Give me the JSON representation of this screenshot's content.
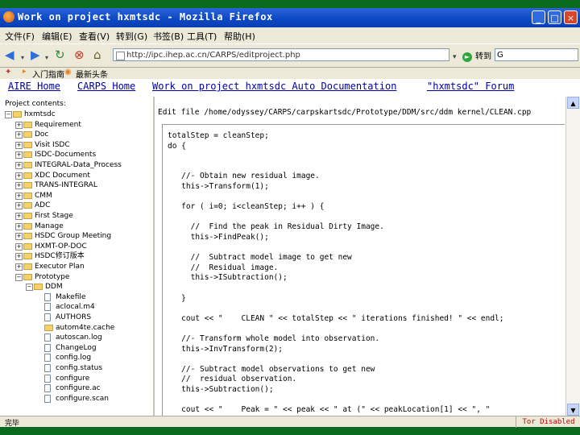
{
  "window": {
    "title": "Work on project hxmtsdc - Mozilla Firefox"
  },
  "menu": [
    "文件(F)",
    "编辑(E)",
    "查看(V)",
    "转到(G)",
    "书签(B)",
    "工具(T)",
    "帮助(H)"
  ],
  "nav": {
    "url": "http://ipc.ihep.ac.cn/CARPS/editproject.php",
    "go_label": "转到",
    "search_value": "G"
  },
  "bookmarks": [
    "入门指南",
    "最新头条"
  ],
  "links": [
    "AIRE Home",
    "CARPS Home",
    "Work on project hxmtsdc Auto Documentation",
    "\"hxmtsdc\" Forum"
  ],
  "tree": {
    "header": "Project contents:",
    "items": [
      {
        "label": "hxmtsdc",
        "type": "folder",
        "exp": "−",
        "indent": 0
      },
      {
        "label": "Requirement",
        "type": "folder",
        "exp": "+",
        "indent": 1
      },
      {
        "label": "Doc",
        "type": "folder",
        "exp": "+",
        "indent": 1
      },
      {
        "label": "Visit ISDC",
        "type": "folder",
        "exp": "+",
        "indent": 1
      },
      {
        "label": "ISDC-Documents",
        "type": "folder",
        "exp": "+",
        "indent": 1
      },
      {
        "label": "INTEGRAL-Data_Process",
        "type": "folder",
        "exp": "+",
        "indent": 1
      },
      {
        "label": "XDC Document",
        "type": "folder",
        "exp": "+",
        "indent": 1
      },
      {
        "label": "TRANS-INTEGRAL",
        "type": "folder",
        "exp": "+",
        "indent": 1
      },
      {
        "label": "CMM",
        "type": "folder",
        "exp": "+",
        "indent": 1
      },
      {
        "label": "ADC",
        "type": "folder",
        "exp": "+",
        "indent": 1
      },
      {
        "label": "First Stage",
        "type": "folder",
        "exp": "+",
        "indent": 1
      },
      {
        "label": "Manage",
        "type": "folder",
        "exp": "+",
        "indent": 1
      },
      {
        "label": "HSDC Group Meeting",
        "type": "folder",
        "exp": "+",
        "indent": 1
      },
      {
        "label": "HXMT-OP-DOC",
        "type": "folder",
        "exp": "+",
        "indent": 1
      },
      {
        "label": "HSDC修订版本",
        "type": "folder",
        "exp": "+",
        "indent": 1
      },
      {
        "label": "Executor Plan",
        "type": "folder",
        "exp": "+",
        "indent": 1
      },
      {
        "label": "Prototype",
        "type": "folder",
        "exp": "−",
        "indent": 1
      },
      {
        "label": "DDM",
        "type": "folder",
        "exp": "−",
        "indent": 2
      },
      {
        "label": "Makefile",
        "type": "file",
        "exp": "",
        "indent": 3
      },
      {
        "label": "aclocal.m4",
        "type": "file",
        "exp": "",
        "indent": 3
      },
      {
        "label": "AUTHORS",
        "type": "file",
        "exp": "",
        "indent": 3
      },
      {
        "label": "autom4te.cache",
        "type": "folder",
        "exp": "",
        "indent": 3
      },
      {
        "label": "autoscan.log",
        "type": "file",
        "exp": "",
        "indent": 3
      },
      {
        "label": "ChangeLog",
        "type": "file",
        "exp": "",
        "indent": 3
      },
      {
        "label": "config.log",
        "type": "file",
        "exp": "",
        "indent": 3
      },
      {
        "label": "config.status",
        "type": "file",
        "exp": "",
        "indent": 3
      },
      {
        "label": "configure",
        "type": "file",
        "exp": "",
        "indent": 3
      },
      {
        "label": "configure.ac",
        "type": "file",
        "exp": "",
        "indent": 3
      },
      {
        "label": "configure.scan",
        "type": "file",
        "exp": "",
        "indent": 3
      }
    ]
  },
  "editor": {
    "title": "Edit file /home/odyssey/CARPS/carpskartsdc/Prototype/DDM/src/ddm kernel/CLEAN.cpp",
    "lines": [
      "totalStep = cleanStep;",
      "do {",
      "",
      "",
      "   //- Obtain new residual image.",
      "   this->Transform(1);",
      "",
      "   for ( i=0; i<cleanStep; i++ ) {",
      "",
      "     //  Find the peak in Residual Dirty Image.",
      "     this->FindPeak();",
      "",
      "     //  Subtract model image to get new",
      "     //  Residual image.",
      "     this->ISubtraction();",
      "",
      "   }",
      "",
      "   cout << \"    CLEAN \" << totalStep << \" iterations finished! \" << endl;",
      "",
      "   //- Transform whole model into observation.",
      "   this->InvTransform(2);",
      "",
      "   //- Subtract model observations to get new",
      "   //  residual observation.",
      "   this->Subtraction();",
      "",
      "   cout << \"    Peak = \" << peak << \" at (\" << peakLocation[1] << \", \""
    ]
  },
  "status": {
    "left": "完毕",
    "right": "Tor Disabled"
  }
}
